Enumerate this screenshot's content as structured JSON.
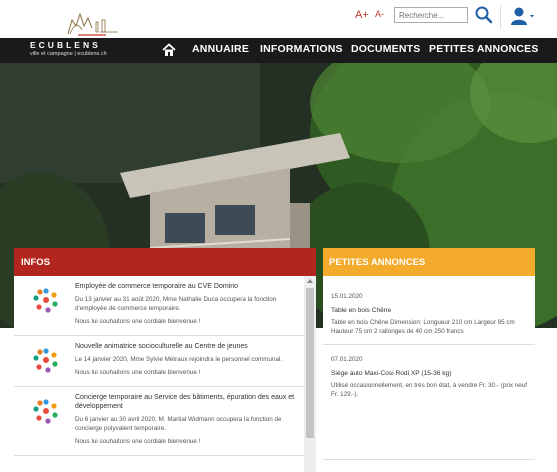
{
  "header": {
    "font_increase": "A+",
    "font_decrease": "A-",
    "search_placeholder": "Recherche..."
  },
  "brand": {
    "name": "ECUBLENS",
    "tagline": "ville et campagne | ecublens.ch"
  },
  "nav": {
    "items": [
      "ANNUAIRE",
      "INFORMATIONS",
      "DOCUMENTS",
      "PETITES ANNONCES"
    ]
  },
  "infos": {
    "title": "INFOS",
    "items": [
      {
        "title": "Employée de commerce temporaire au CVE Domino",
        "text": "Du 13 janvier au 31 août 2020, Mme Nathalie Duca occupera la fonction d'employée de commerce temporaire.",
        "greeting": "Nous lui souhaitons une cordiale bienvenue !"
      },
      {
        "title": "Nouvelle animatrice socioculturelle au Centre de jeunes",
        "text": "Le 14 janvier 2020, Mme Sylvie Métraux rejoindra le personnel communal.",
        "greeting": "Nous lui souhaitons une cordiale bienvenue !"
      },
      {
        "title": "Concierge temporaire au Service des bâtiments, épuration des eaux et développement",
        "text": "Du 6 janvier au 30 avril 2020, M. Martial Widmann occupera la fonction de concierge polyvalent temporaire.",
        "greeting": "Nous lui souhaitons une cordiale bienvenue !"
      }
    ]
  },
  "petites_annonces": {
    "title": "PETITES ANNONCES",
    "items": [
      {
        "date": "15.01.2020",
        "title": "Table en bois Chêne",
        "text": "Table en bois Chêne Dimension: Longueur 210 cm Largeur 95 cm Hauteur 75 cm 2 rallonges de 40 cm  250 francs"
      },
      {
        "date": "07.01.2020",
        "title": "Siège auto Maxi-Cosi Rodi XP (15-36 kg)",
        "text": "Utilisé occasionnellement, en très bon état, à vendre Fr. 30.- (prix neuf Fr. 129.-)."
      }
    ]
  },
  "colors": {
    "infos_header": "#b2261f",
    "annonces_header": "#f4aa2a",
    "nav_background": "#1a1a1a",
    "accent_blue": "#1f5fa8"
  },
  "icons": {
    "search": "search-icon",
    "user": "user-icon",
    "home": "home-icon",
    "caret": "caret-down-icon"
  }
}
